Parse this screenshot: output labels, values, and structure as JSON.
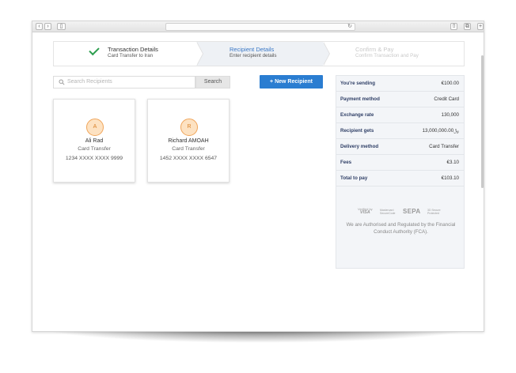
{
  "browser": {
    "reload_icon": "reload-icon"
  },
  "steps": [
    {
      "title": "Transaction Details",
      "subtitle": "Card Transfer to Iran",
      "state": "done"
    },
    {
      "title": "Recipient Details",
      "subtitle": "Enter recipient details",
      "state": "active"
    },
    {
      "title": "Confirm & Pay",
      "subtitle": "Confirm Transaction and Pay",
      "state": "pending"
    }
  ],
  "search": {
    "placeholder": "Search Recipients",
    "button": "Search"
  },
  "new_recipient": "+ New Recipient",
  "recipients": [
    {
      "initial": "A",
      "name": "Ali Rad",
      "type": "Card Transfer",
      "number": "1234 XXXX XXXX 9999"
    },
    {
      "initial": "R",
      "name": "Richard AMOAH",
      "type": "Card Transfer",
      "number": "1452 XXXX XXXX 6547"
    }
  ],
  "summary": {
    "rows": [
      {
        "label": "You're sending",
        "value": "€100.00"
      },
      {
        "label": "Payment method",
        "value": "Credit Card"
      },
      {
        "label": "Exchange rate",
        "value": "130,000"
      },
      {
        "label": "Recipient gets",
        "value": "13,000,000.00﷼"
      },
      {
        "label": "Delivery method",
        "value": "Card Transfer"
      },
      {
        "label": "Fees",
        "value": "€3.10"
      },
      {
        "label": "Total to pay",
        "value": "€103.10"
      }
    ],
    "logos": {
      "visa_top": "Verified by",
      "visa_main": "VISA",
      "mastercard_top": "Mastercard",
      "mastercard_bottom": "SecureCode",
      "sepa": "SEPA",
      "secure_top": "3D Secure",
      "secure_bottom": "Protected"
    },
    "regulated": "We are Authorised and Regulated by the Financial Conduct Authority (FCA)."
  },
  "colors": {
    "accent": "#2a7dd1",
    "step_active": "#3a77c5",
    "check": "#2e9e4f",
    "avatar_bg": "#fde2c2",
    "summary_label": "#2f3f66"
  }
}
